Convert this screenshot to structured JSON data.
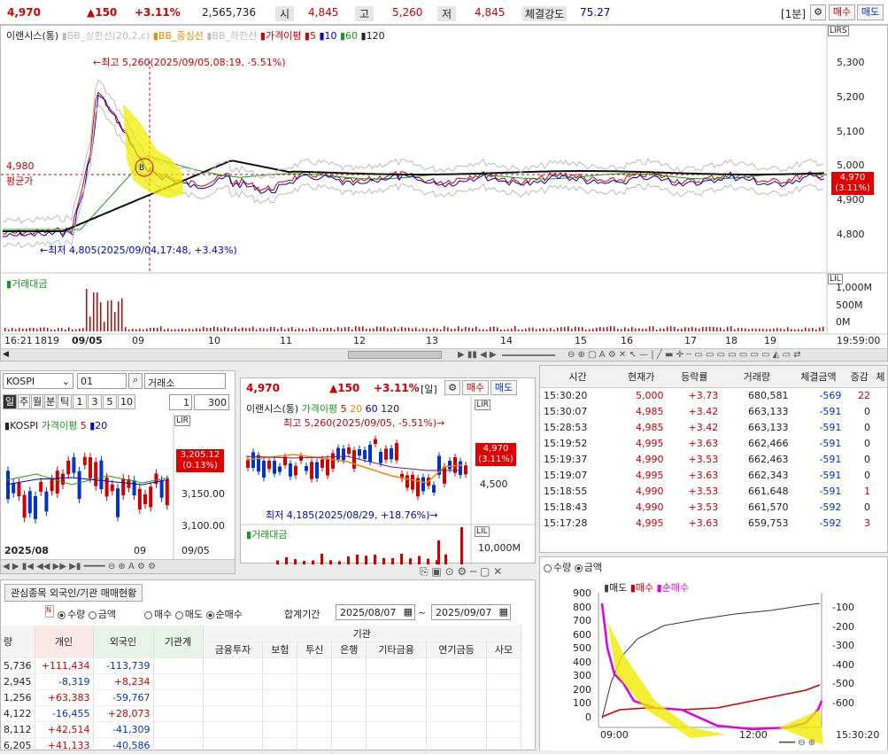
{
  "top": {
    "price": "4,970",
    "change": "▲150",
    "pct": "+3.11%",
    "volume": "2,565,736",
    "open_label": "시",
    "open": "4,845",
    "high_label": "고",
    "high": "5,260",
    "low_label": "저",
    "low": "4,845",
    "strength_label": "체결강도",
    "strength": "75.27",
    "interval": "[1분]",
    "buy": "매수",
    "sell": "매도"
  },
  "main_chart": {
    "name": "이랜시스(통)",
    "legend": [
      {
        "label": "BB_상한선(20,2,c)",
        "color": "#bbbbbb"
      },
      {
        "label": "BB_중심선",
        "color": "#f08a00"
      },
      {
        "label": "BB_하한선",
        "color": "#bbbbbb"
      },
      {
        "label": "가격이평",
        "color": "#d00000"
      },
      {
        "label": "5",
        "color": "#d00000"
      },
      {
        "label": "10",
        "color": "#0000c8"
      },
      {
        "label": "60",
        "color": "#1a9a1a"
      },
      {
        "label": "120",
        "color": "#222222"
      }
    ],
    "high_note": "←최고 5,260(2025/09/05,08:19, -5.51%)",
    "low_note": "←최저 4,805(2025/09/04,17:48, +3.43%)",
    "avg_price": "4,980",
    "avg_label": "평균가",
    "y_ticks": [
      "5,300",
      "5,200",
      "5,100",
      "5,000",
      "4,900",
      "4,800"
    ],
    "price_box": "4,970",
    "price_box_pct": "(3.11%)",
    "scale_label": "LIRS",
    "vol_title": "거래대금",
    "vol_ticks": [
      "1,000M",
      "500M",
      "0M"
    ],
    "x_ticks": [
      "16:21",
      "1819",
      "09/05",
      "09",
      "10",
      "11",
      "12",
      "13",
      "14",
      "15",
      "16",
      "17",
      "18",
      "19",
      "19:59:00"
    ]
  },
  "kospi": {
    "code": "KOSPI",
    "num": "01",
    "market": "거래소",
    "periods": [
      "일",
      "주",
      "월",
      "분",
      "틱",
      "1",
      "3",
      "5",
      "10"
    ],
    "count_sel": "1",
    "count": "300",
    "name": "KOSPI",
    "ma_label": "가격이평",
    "ma5": "5",
    "ma20": "20",
    "price": "3,205.12",
    "pct": "(0.13%)",
    "y_ticks": [
      "3,150.00",
      "3,100.00"
    ],
    "x_ticks": [
      "2025/08",
      "09",
      "09/05"
    ],
    "scale": "LIR"
  },
  "daily": {
    "price": "4,970",
    "change": "▲150",
    "pct": "+3.11%",
    "period": "[일]",
    "buy": "매수",
    "sell": "매도",
    "name": "이랜시스(통)",
    "ma_label": "가격이평",
    "ma5": "5",
    "ma20": "20",
    "ma60": "60",
    "ma120": "120",
    "high_note": "최고 5,260(2025/09/05, -5.51%)→",
    "low_note": "최저 4,185(2025/08/29, +18.76%)→",
    "price_box": "4,970",
    "price_box_pct": "(3.11%)",
    "y_tick": "4,500",
    "vol_title": "거래대금",
    "vol_tick": "10,000M",
    "scale": "LIR"
  },
  "ticks": {
    "headers": [
      "시간",
      "현재가",
      "등락률",
      "거래량",
      "체결금액",
      "증감",
      "체"
    ],
    "rows": [
      [
        "15:30:20",
        "5,000",
        "+3.73",
        "680,581",
        "-569",
        "22"
      ],
      [
        "15:30:07",
        "4,985",
        "+3.42",
        "663,133",
        "-591",
        "0"
      ],
      [
        "15:28:53",
        "4,985",
        "+3.42",
        "663,133",
        "-591",
        "0"
      ],
      [
        "15:19:52",
        "4,995",
        "+3.63",
        "662,466",
        "-591",
        "0"
      ],
      [
        "15:19:37",
        "4,990",
        "+3.53",
        "662,463",
        "-591",
        "0"
      ],
      [
        "15:19:07",
        "4,995",
        "+3.63",
        "662,343",
        "-591",
        "0"
      ],
      [
        "15:18:55",
        "4,990",
        "+3.53",
        "661,648",
        "-591",
        "1"
      ],
      [
        "15:18:43",
        "4,990",
        "+3.53",
        "661,570",
        "-592",
        "0"
      ],
      [
        "15:17:28",
        "4,995",
        "+3.63",
        "659,753",
        "-592",
        "3"
      ]
    ]
  },
  "flow_chart": {
    "radio_qty": "수량",
    "radio_amt": "금액",
    "legend_sell": "매도",
    "legend_buy": "매수",
    "legend_net": "순매수",
    "left_ticks": [
      "900",
      "800",
      "700",
      "600",
      "500",
      "400",
      "300",
      "200",
      "100",
      "0"
    ],
    "right_ticks": [
      "-100",
      "-200",
      "-300",
      "-400",
      "-500",
      "-600"
    ],
    "x_ticks": [
      "09:00",
      "12:00",
      "15:30:20"
    ]
  },
  "investor": {
    "tab_label": "관심종목 외국인/기관 매매현황",
    "radio_qty": "수량",
    "radio_amt": "금액",
    "radio_buy": "매수",
    "radio_sell": "매도",
    "radio_net": "순매수",
    "period_label": "합계기간",
    "date_from": "2025/08/07",
    "tilde": "~",
    "date_to": "2025/09/07",
    "col_first": "량",
    "col_individual": "개인",
    "col_foreign": "외국인",
    "col_inst_total": "기관계",
    "inst_group": "기관",
    "inst_cols": [
      "금융투자",
      "보험",
      "투신",
      "은행",
      "기타금융",
      "연기금등",
      "사모"
    ],
    "rows": [
      [
        "5,736",
        "+111,434",
        "-113,739"
      ],
      [
        "2,945",
        "-8,319",
        "+8,234"
      ],
      [
        "1,256",
        "+63,383",
        "-59,767"
      ],
      [
        "4,122",
        "-16,455",
        "+28,073"
      ],
      [
        "8,112",
        "+42,514",
        "-41,309"
      ],
      [
        "6,205",
        "+41,133",
        "-40,586"
      ]
    ]
  }
}
